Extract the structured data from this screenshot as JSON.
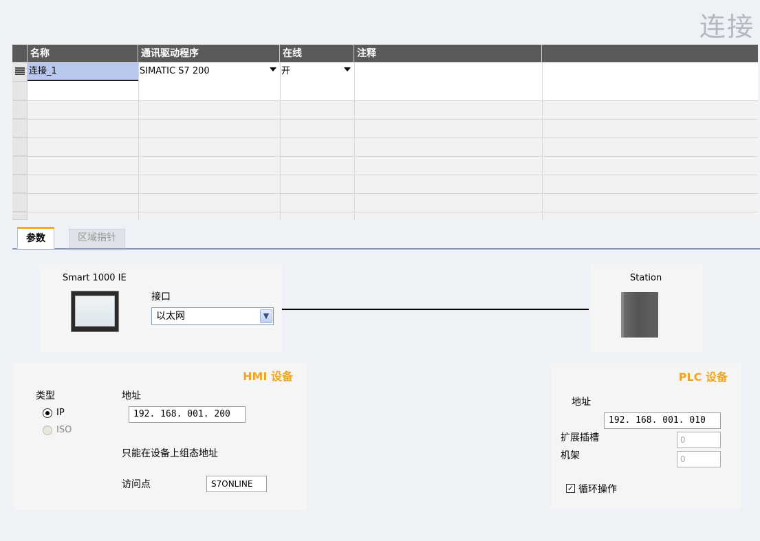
{
  "header": {
    "title": "连接"
  },
  "table": {
    "columns": [
      "名称",
      "通讯驱动程序",
      "在线",
      "注释",
      ""
    ],
    "rows": [
      {
        "name": "连接_1",
        "driver": "SIMATIC S7 200",
        "online": "开",
        "comment": ""
      }
    ]
  },
  "tabs": [
    {
      "label": "参数",
      "active": true
    },
    {
      "label": "区域指针",
      "active": false
    }
  ],
  "hmi": {
    "device_name": "Smart 1000 IE",
    "interface_label": "接口",
    "interface_value": "以太网",
    "panel_title": "HMI 设备",
    "type_label": "类型",
    "type_options": [
      "IP",
      "ISO"
    ],
    "address_label": "地址",
    "address_value": "192. 168. 001. 200",
    "note": "只能在设备上组态地址",
    "access_point_label": "访问点",
    "access_point_value": "S7ONLINE"
  },
  "plc": {
    "device_name": "Station",
    "panel_title": "PLC 设备",
    "address_label": "地址",
    "address_value": "192. 168. 001. 010",
    "expansion_slot_label": "扩展插槽",
    "expansion_slot_value": "0",
    "rack_label": "机架",
    "rack_value": "0",
    "cyclic_label": "循环操作",
    "cyclic_checked": true
  },
  "colors": {
    "accent": "#f0a422",
    "header_bg": "#5a5a5a",
    "selection": "#b9c7ee"
  }
}
